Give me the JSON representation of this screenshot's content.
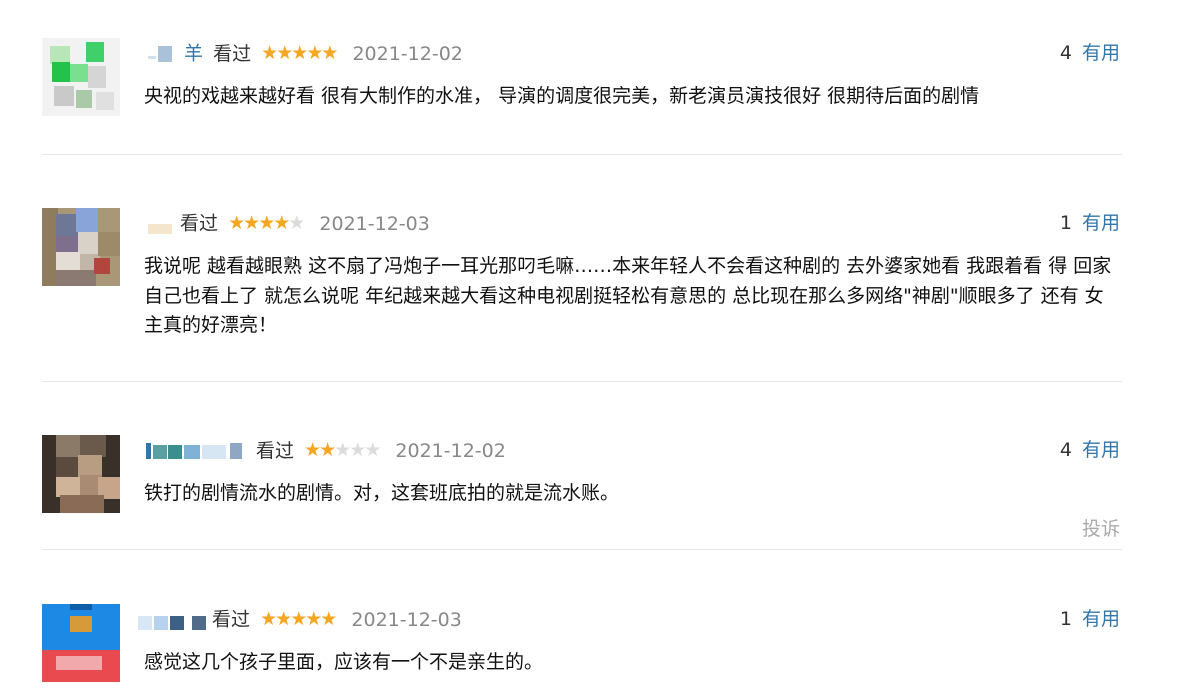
{
  "comments": [
    {
      "user_name": "羊",
      "status": "看过",
      "rating": 5,
      "date": "2021-12-02",
      "useful_count": "4",
      "useful_label": "有用",
      "text": "央视的戏越来越好看 很有大制作的水准， 导演的调度很完美，新老演员演技很好 很期待后面的剧情"
    },
    {
      "user_name": "",
      "status": "看过",
      "rating": 4,
      "date": "2021-12-03",
      "useful_count": "1",
      "useful_label": "有用",
      "text": "我说呢 越看越眼熟 这不扇了冯炮子一耳光那叼毛嘛……本来年轻人不会看这种剧的 去外婆家她看 我跟着看 得 回家自己也看上了 就怎么说呢 年纪越来越大看这种电视剧挺轻松有意思的 总比现在那么多网络\"神剧\"顺眼多了 还有 女主真的好漂亮！"
    },
    {
      "user_name": "",
      "status": "看过",
      "rating": 2,
      "date": "2021-12-02",
      "useful_count": "4",
      "useful_label": "有用",
      "text": "铁打的剧情流水的剧情。对，这套班底拍的就是流水账。",
      "report_label": "投诉"
    },
    {
      "user_name": "",
      "status": "看过",
      "rating": 5,
      "date": "2021-12-03",
      "useful_count": "1",
      "useful_label": "有用",
      "text": "感觉这几个孩子里面，应该有一个不是亲生的。"
    }
  ],
  "colors": {
    "link": "#3377aa",
    "star_on": "#f5a623",
    "star_off": "#dcdcdc",
    "date": "#888888",
    "divider": "#e6e6e6",
    "report": "#aaaaaa"
  },
  "icons": {
    "star": "★"
  }
}
